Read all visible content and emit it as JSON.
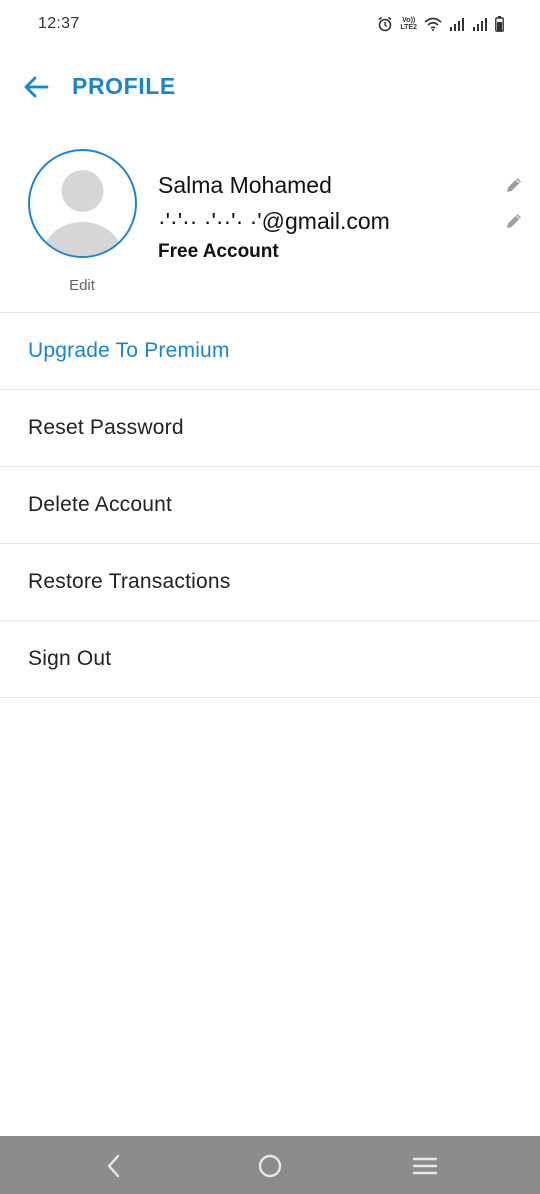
{
  "status_bar": {
    "time": "12:37",
    "volte_top": "Vo))",
    "volte_bottom": "LTE2",
    "icons": [
      "alarm-icon",
      "volte-icon",
      "wifi-icon",
      "signal-icon",
      "signal-icon",
      "battery-icon"
    ]
  },
  "header": {
    "title": "PROFILE",
    "back_icon": "arrow-left-icon"
  },
  "profile": {
    "name": "Salma Mohamed",
    "email": "·'·'·· ·'··'· ·'@gmail.com",
    "account_type": "Free Account",
    "avatar_edit_label": "Edit",
    "edit_icon": "pencil-icon"
  },
  "menu": {
    "items": [
      {
        "label": "Upgrade To Premium"
      },
      {
        "label": "Reset Password"
      },
      {
        "label": "Delete Account"
      },
      {
        "label": "Restore Transactions"
      },
      {
        "label": "Sign Out"
      }
    ]
  },
  "nav_bar": {
    "icons": [
      "back-chevron-icon",
      "home-circle-icon",
      "menu-lines-icon"
    ]
  },
  "colors": {
    "accent": "#1a84d4",
    "divider": "#e4e4e4",
    "nav_bar": "#8c8c8c"
  }
}
